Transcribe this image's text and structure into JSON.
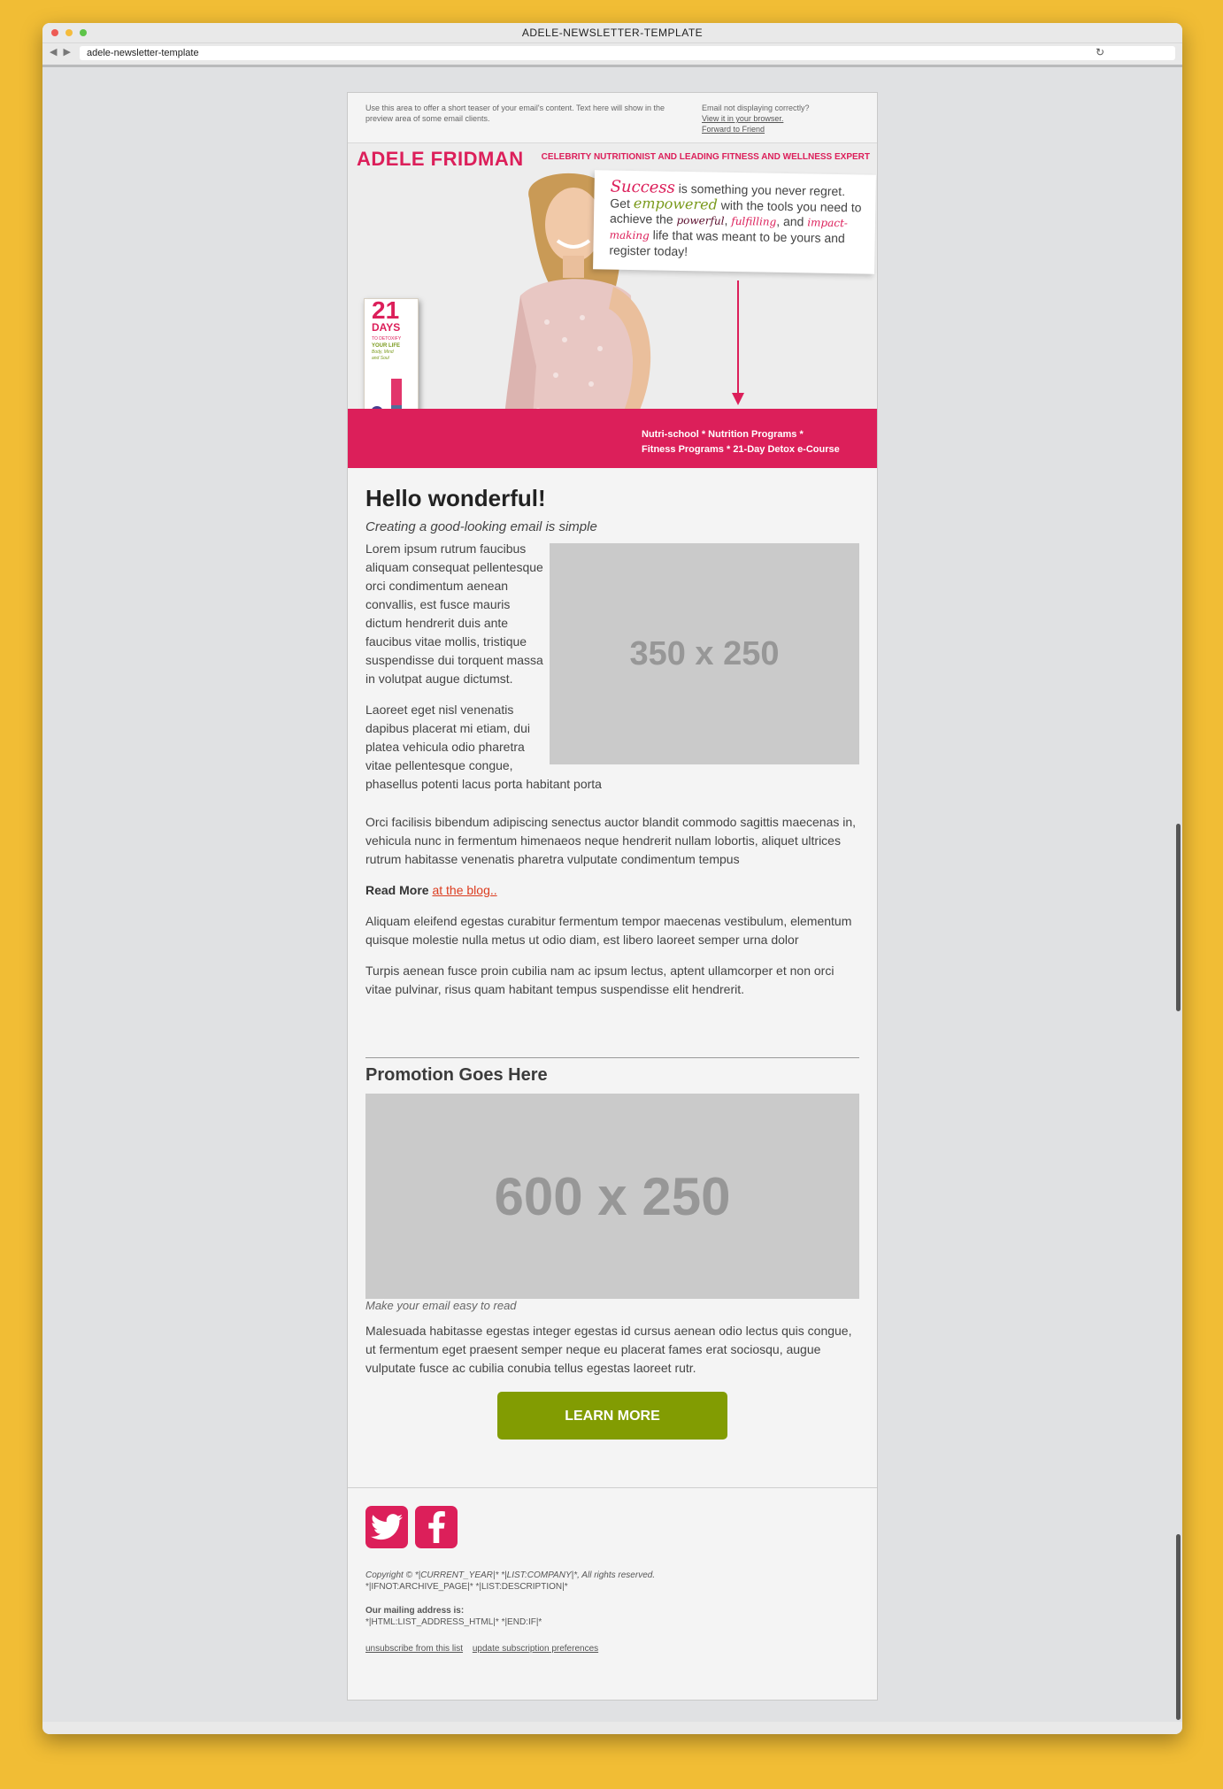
{
  "window": {
    "title": "ADELE-NEWSLETTER-TEMPLATE",
    "url": "adele-newsletter-template",
    "nav_arrows": "◀ ▶",
    "reload_icon": "↻"
  },
  "preheader": {
    "teaser": "Use this area to offer a short teaser of your email's content. Text here will show in the preview area of some email clients.",
    "not_displaying": "Email not displaying correctly?",
    "view_browser": "View it in your browser.",
    "forward": "Forward to Friend"
  },
  "hero": {
    "brand": "ADELE FRIDMAN",
    "tagline": "CELEBRITY NUTRITIONIST AND LEADING FITNESS AND WELLNESS EXPERT",
    "quote": {
      "w1": "Success",
      "t1": " is something you never regret. Get ",
      "w2": "empowered",
      "t2": " with the tools you need to achieve the ",
      "w3": "powerful",
      "t3": ", ",
      "w4": "fulfilling",
      "t4": ", and ",
      "w5": "impact-making",
      "t5": " life that was meant to be yours and register today!"
    },
    "book": {
      "number": "21",
      "days": "DAYS",
      "line1": "TO DETOXIFY",
      "line2": "YOUR LIFE",
      "line3": "Body, Mind and Soul"
    },
    "programs_line1": "Nutri-school * Nutrition Programs *",
    "programs_line2": "Fitness Programs * 21-Day Detox e-Course"
  },
  "content": {
    "heading": "Hello wonderful!",
    "subheading": "Creating a good-looking email is simple",
    "image_label": "350 x 250",
    "p1": "Lorem ipsum rutrum faucibus aliquam consequat pellentesque orci condimentum aenean convallis, est fusce mauris dictum hendrerit duis ante faucibus vitae mollis, tristique suspendisse dui torquent massa in volutpat augue dictumst.",
    "p2": "Laoreet eget nisl venenatis dapibus placerat mi etiam, dui platea vehicula odio pharetra vitae pellentesque congue, phasellus potenti lacus porta habitant porta",
    "p3": "Orci facilisis bibendum adipiscing senectus auctor blandit commodo sagittis maecenas in, vehicula nunc in fermentum himenaeos neque hendrerit nullam lobortis, aliquet ultrices rutrum habitasse venenatis pharetra vulputate condimentum tempus",
    "read_more_label": "Read More",
    "read_more_link": "at the blog..",
    "p4": "Aliquam eleifend egestas curabitur fermentum tempor maecenas vestibulum, elementum quisque molestie nulla metus ut odio diam, est libero laoreet semper urna dolor",
    "p5": "Turpis aenean fusce proin cubilia nam ac ipsum lectus, aptent ullamcorper et non orci vitae pulvinar, risus quam habitant tempus suspendisse elit hendrerit."
  },
  "promo": {
    "heading": "Promotion Goes Here",
    "image_label": "600 x 250",
    "caption": "Make your email easy to read",
    "text": "Malesuada habitasse egestas integer egestas id cursus aenean odio lectus quis congue, ut fermentum eget praesent semper neque eu placerat fames erat sociosqu, augue vulputate fusce ac cubilia conubia tellus egestas laoreet rutr.",
    "button": "LEARN MORE"
  },
  "footer": {
    "social_icons": [
      "twitter-icon",
      "facebook-icon"
    ],
    "copyright": "Copyright © *|CURRENT_YEAR|* *|LIST:COMPANY|*, All rights reserved.",
    "archive": "*|IFNOT:ARCHIVE_PAGE|* *|LIST:DESCRIPTION|*",
    "mailing_label": "Our mailing address is:",
    "mailing_address": "*|HTML:LIST_ADDRESS_HTML|* *|END:IF|*",
    "unsubscribe": "unsubscribe from this list",
    "update_prefs": "update subscription preferences"
  },
  "colors": {
    "brand_pink": "#dc1f5a",
    "button_green": "#829c02",
    "page_background": "#f1bd35"
  }
}
